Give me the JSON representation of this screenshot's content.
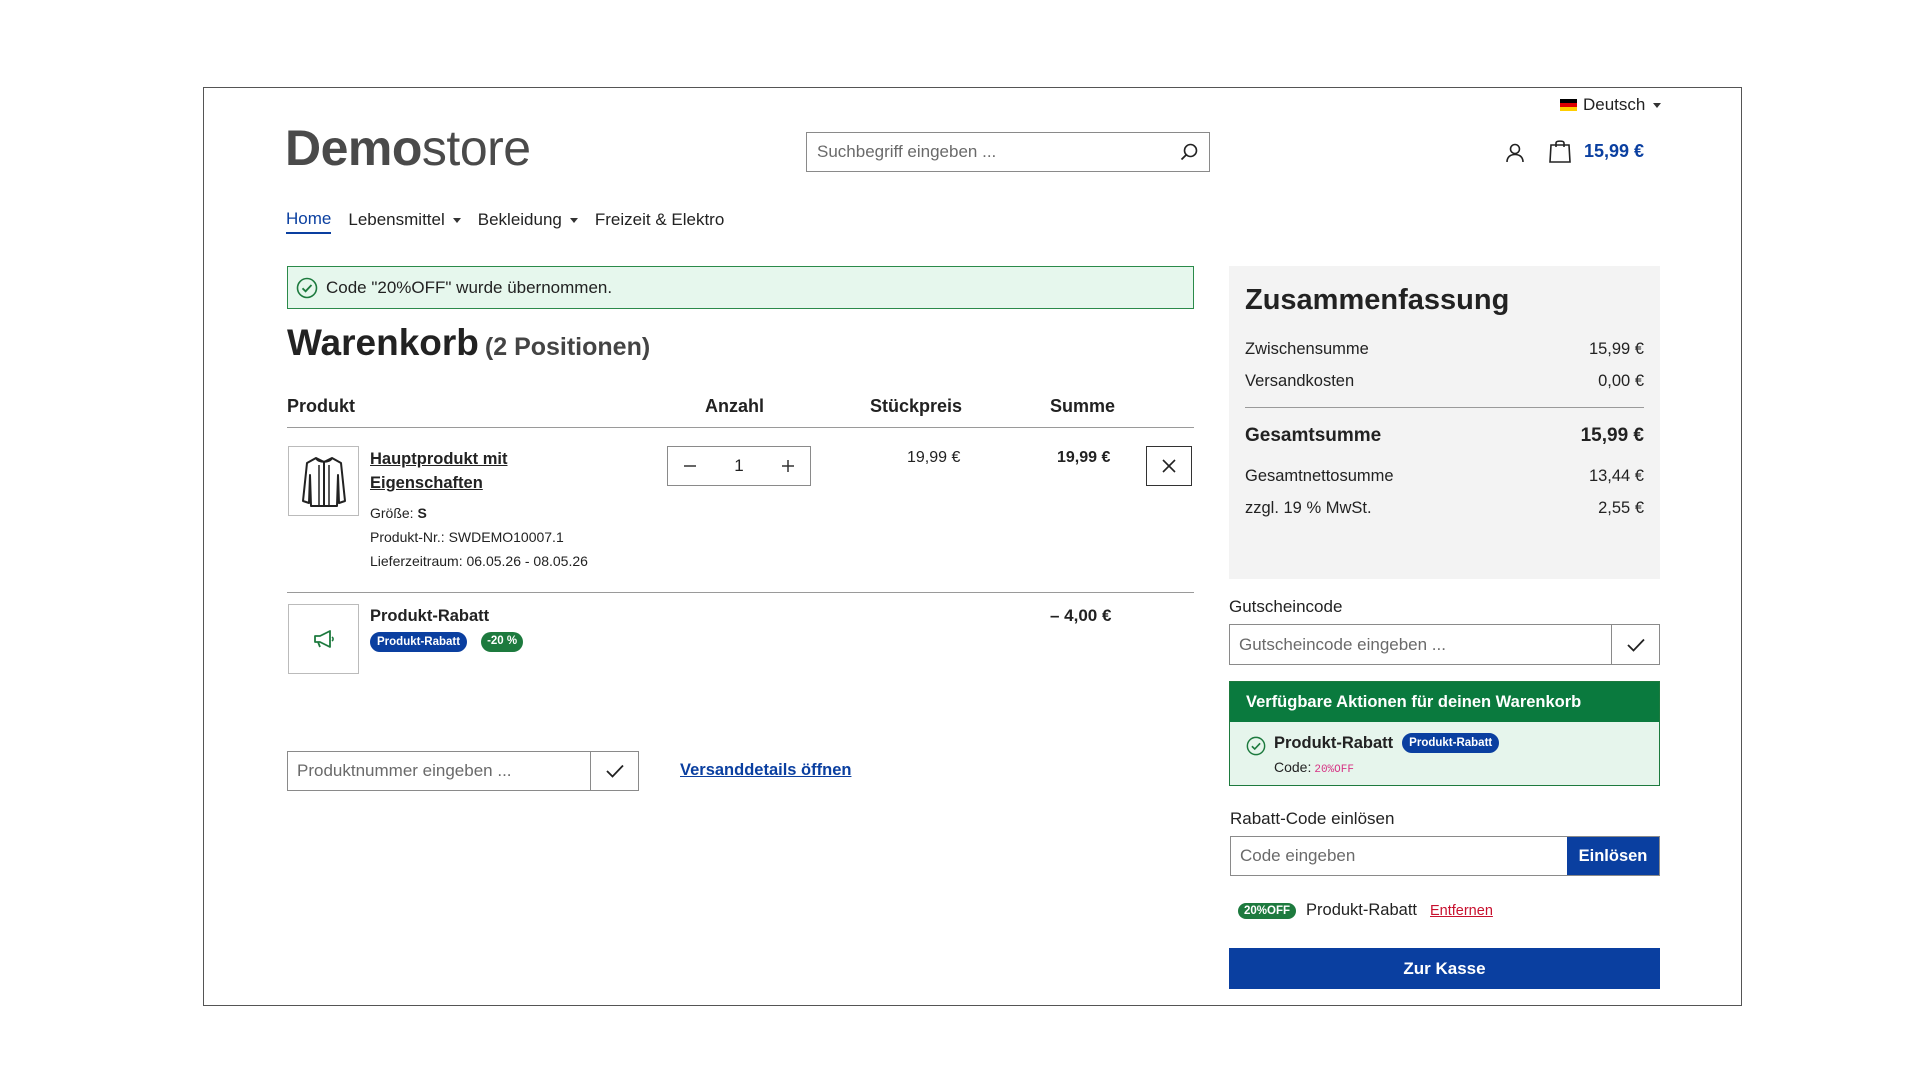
{
  "header": {
    "language": "Deutsch",
    "logo_bold": "Demo",
    "logo_light": "store",
    "search_placeholder": "Suchbegriff eingeben ...",
    "cart_total": "15,99 €"
  },
  "nav": {
    "items": [
      {
        "label": "Home",
        "active": true,
        "dropdown": false
      },
      {
        "label": "Lebensmittel",
        "active": false,
        "dropdown": true
      },
      {
        "label": "Bekleidung",
        "active": false,
        "dropdown": true
      },
      {
        "label": "Freizeit & Elektro",
        "active": false,
        "dropdown": false
      }
    ]
  },
  "alert": {
    "message": "Code \"20%OFF\" wurde übernommen."
  },
  "cart": {
    "title": "Warenkorb",
    "count": "(2 Positionen)",
    "columns": {
      "product": "Produkt",
      "quantity": "Anzahl",
      "unit_price": "Stückpreis",
      "total": "Summe"
    },
    "items": [
      {
        "name": "Hauptprodukt mit Eigenschaften",
        "size_label": "Größe:",
        "size_value": "S",
        "number": "Produkt-Nr.: SWDEMO10007.1",
        "delivery": "Lieferzeitraum: 06.05.26 - 08.05.26",
        "quantity": "1",
        "unit_price": "19,99 €",
        "total": "19,99 €"
      }
    ],
    "discount": {
      "name": "Produkt-Rabatt",
      "badge": "Produkt-Rabatt",
      "percent": "-20 %",
      "total": "– 4,00 €"
    },
    "product_number_placeholder": "Produktnummer eingeben ...",
    "shipping_link": "Versanddetails öffnen"
  },
  "summary": {
    "title": "Zusammenfassung",
    "subtotal_label": "Zwischensumme",
    "subtotal_value": "15,99 €",
    "shipping_label": "Versandkosten",
    "shipping_value": "0,00 €",
    "total_label": "Gesamtsumme",
    "total_value": "15,99 €",
    "net_label": "Gesamtnettosumme",
    "net_value": "13,44 €",
    "vat_label": "zzgl. 19 % MwSt.",
    "vat_value": "2,55 €"
  },
  "voucher": {
    "label": "Gutscheincode",
    "placeholder": "Gutscheincode eingeben ..."
  },
  "actions": {
    "header": "Verfügbare Aktionen für deinen Warenkorb",
    "name": "Produkt-Rabatt",
    "badge": "Produkt-Rabatt",
    "code_label": "Code:",
    "code": "20%OFF"
  },
  "promo": {
    "label": "Rabatt-Code einlösen",
    "placeholder": "Code eingeben",
    "button": "Einlösen",
    "applied_code": "20%OFF",
    "applied_name": "Produkt-Rabatt",
    "remove": "Entfernen"
  },
  "checkout": {
    "label": "Zur Kasse"
  },
  "colors": {
    "primary": "#0a3fa0",
    "success": "#1d7a3e",
    "danger": "#c8102e"
  }
}
